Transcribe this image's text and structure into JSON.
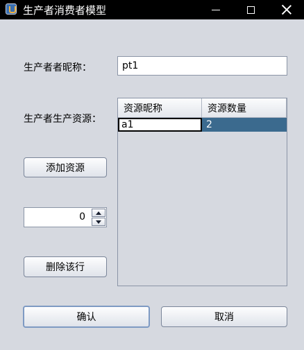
{
  "window": {
    "title": "生产者消费者模型",
    "icon": "java-cup-icon"
  },
  "form": {
    "nickname_label": "生产者者昵称：",
    "nickname_value": "pt1",
    "resources_label": "生产者生产资源：",
    "add_button": "添加资源",
    "spinner_value": "0",
    "delete_button": "删除该行",
    "ok_button": "确认",
    "cancel_button": "取消"
  },
  "table": {
    "columns": [
      "资源昵称",
      "资源数量"
    ],
    "rows": [
      [
        "a1",
        "2"
      ]
    ]
  },
  "colors": {
    "background": "#d6d9e0",
    "titlebar": "#000000",
    "selection": "#3b6a8e"
  }
}
